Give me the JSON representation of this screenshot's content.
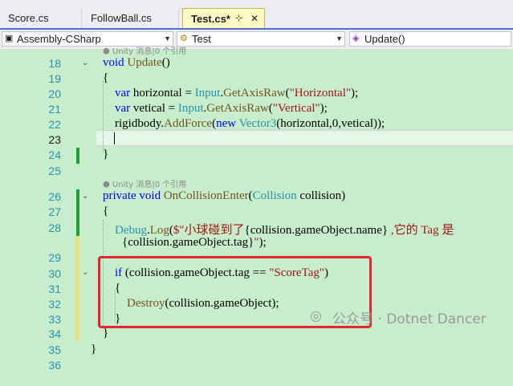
{
  "tabs": [
    {
      "label": "Score.cs"
    },
    {
      "label": "FollowBall.cs"
    },
    {
      "label": "Test.cs*",
      "pin": "⊹",
      "close": "✕"
    }
  ],
  "nav": {
    "project": "Assembly-CSharp",
    "class": "Test",
    "member": "Update()"
  },
  "hints": {
    "h1": "Unity 消息|0 个引用",
    "h2": "Unity 消息|0 个引用"
  },
  "line_numbers": [
    "18",
    "19",
    "20",
    "21",
    "22",
    "23",
    "24",
    "25",
    "26",
    "27",
    "28",
    "29",
    "30",
    "31",
    "32",
    "33",
    "34",
    "35",
    "36"
  ],
  "watermark": "公众号 · Dotnet Dancer"
}
